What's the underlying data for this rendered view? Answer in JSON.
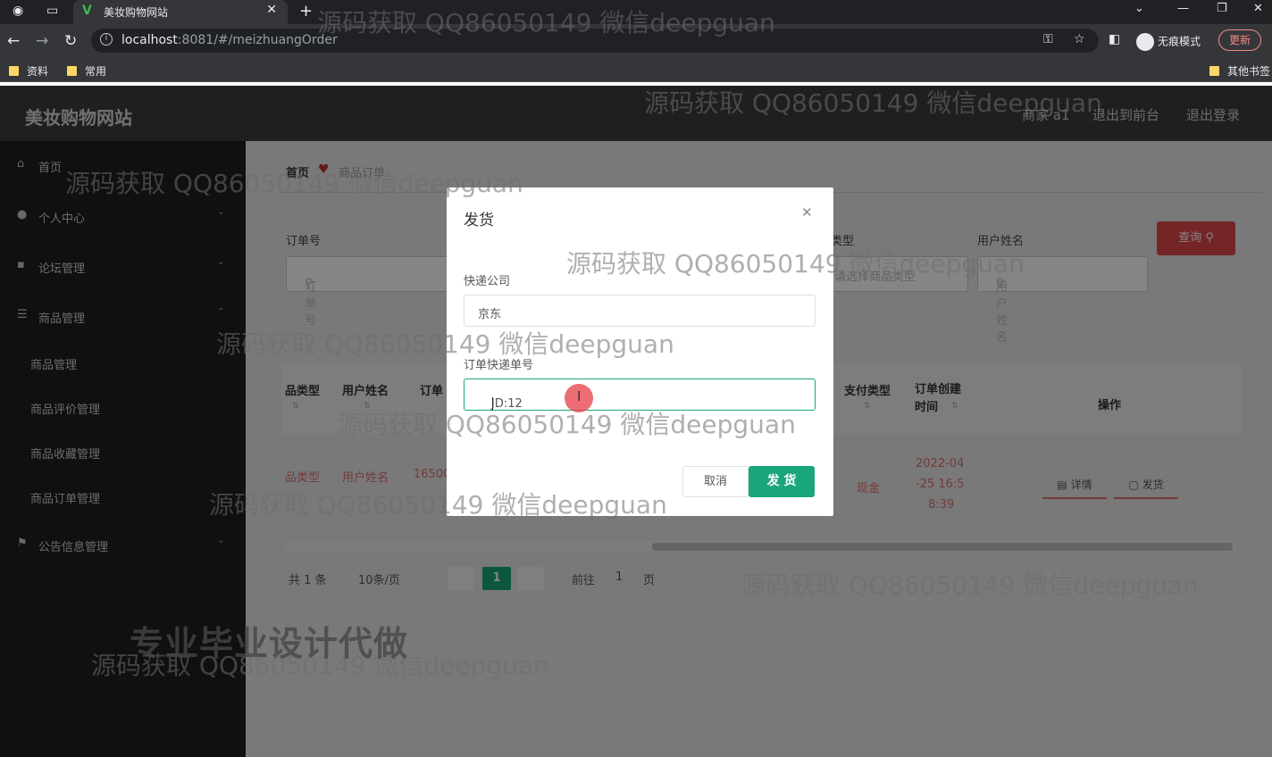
{
  "browser": {
    "tab_title": "美妆购物网站",
    "url_host": "localhost",
    "url_rest": ":8081/#/meizhuangOrder",
    "incognito_label": "无痕模式",
    "update_label": "更新",
    "bookmarks": [
      "资料",
      "常用"
    ],
    "other_bookmarks": "其他书签"
  },
  "header": {
    "site_title": "美妆购物网站",
    "user": "商家 a1",
    "to_front": "退出到前台",
    "logout": "退出登录"
  },
  "sidebar": {
    "home": "首页",
    "personal": "个人中心",
    "forum": "论坛管理",
    "goods": "商品管理",
    "sub": [
      "商品管理",
      "商品评价管理",
      "商品收藏管理",
      "商品订单管理"
    ],
    "notice": "公告信息管理"
  },
  "breadcrumb": {
    "home": "首页",
    "current": "商品订单"
  },
  "filters": {
    "order_no_label": "订单号",
    "order_no_placeholder": "订单号",
    "type_label": "类型",
    "type_placeholder": "请选择商品类型",
    "username_label": "用户姓名",
    "username_placeholder": "用户姓名",
    "query_button": "查询"
  },
  "table": {
    "headers": [
      "品类型",
      "用户姓名",
      "订单",
      "支付类型",
      "订单创建时间",
      "操作"
    ],
    "row": {
      "type": "品类型",
      "username": "用户姓名",
      "order": "16500",
      "pay": "现金",
      "created": [
        "2022-04",
        "-25 16:5",
        "8:39"
      ],
      "detail": "详情",
      "ship": "发货"
    }
  },
  "pagination": {
    "total_prefix": "共",
    "total_count": "1",
    "total_suffix": "条",
    "page_size": "10条/页",
    "current": "1",
    "goto": "前往",
    "goto_page": "1",
    "page": "页"
  },
  "dialog": {
    "title": "发货",
    "courier_label": "快递公司",
    "courier_value": "京东",
    "tracking_label": "订单快递单号",
    "tracking_value": "JD:12",
    "cancel": "取消",
    "confirm": "发 货"
  },
  "watermark": {
    "text": "源码获取 QQ86050149 微信deepguan",
    "big": "专业毕业设计代做"
  },
  "colors": {
    "primary": "#1aa67c",
    "danger": "#e04848"
  }
}
